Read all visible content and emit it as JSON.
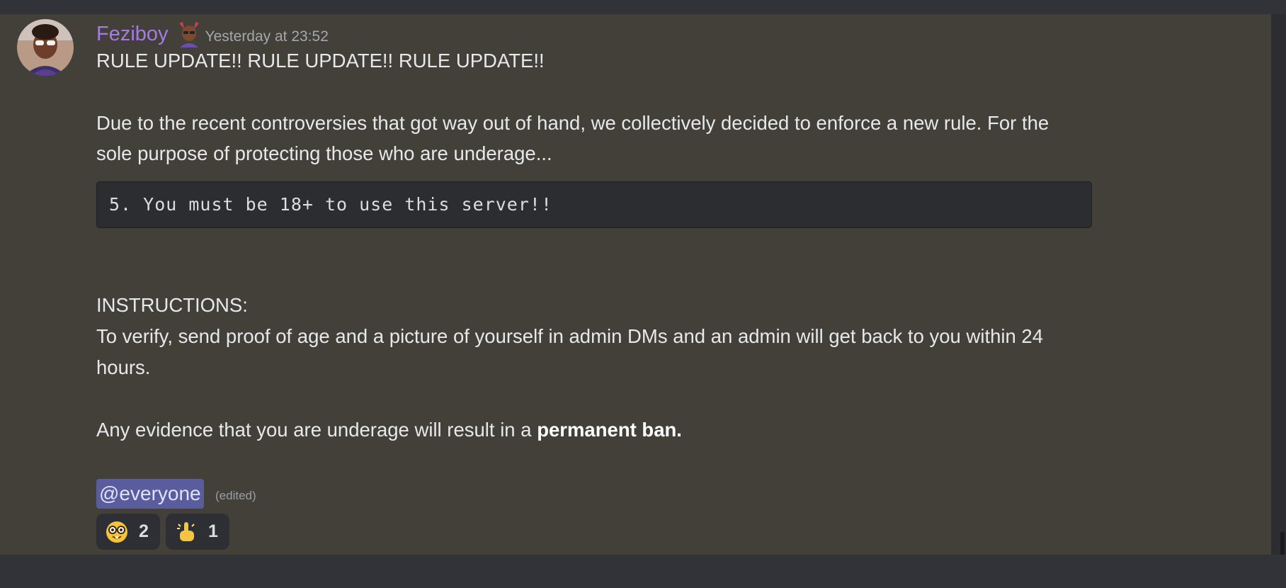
{
  "message": {
    "author": "Feziboy",
    "timestamp": "Yesterday at 23:52",
    "lines": {
      "headline": "RULE UPDATE!! RULE UPDATE!! RULE UPDATE!!",
      "para1_line1": "Due to the recent controversies that got way out of hand, we collectively decided to enforce a new rule. For the",
      "para1_line2": "sole purpose of protecting those who are underage...",
      "code": "5. You must be 18+ to use this server!!",
      "instructions_heading": "INSTRUCTIONS:",
      "instructions_line1": "To verify, send proof of age and a picture of yourself in admin DMs and an admin will get back to you within 24",
      "instructions_line2": "hours.",
      "evidence_prefix": "Any evidence that you are underage will result in a ",
      "evidence_bold": "permanent ban."
    },
    "mention": "@everyone",
    "edited_label": "(edited)",
    "reactions": [
      {
        "emoji": "nerd-face-icon",
        "count": "2"
      },
      {
        "emoji": "pointing-finger-icon",
        "count": "1"
      }
    ]
  },
  "colors": {
    "username": "#a57ce0",
    "message_background": "#424039",
    "mention_background": "#595c9d",
    "reaction_background": "#2e2f35"
  }
}
